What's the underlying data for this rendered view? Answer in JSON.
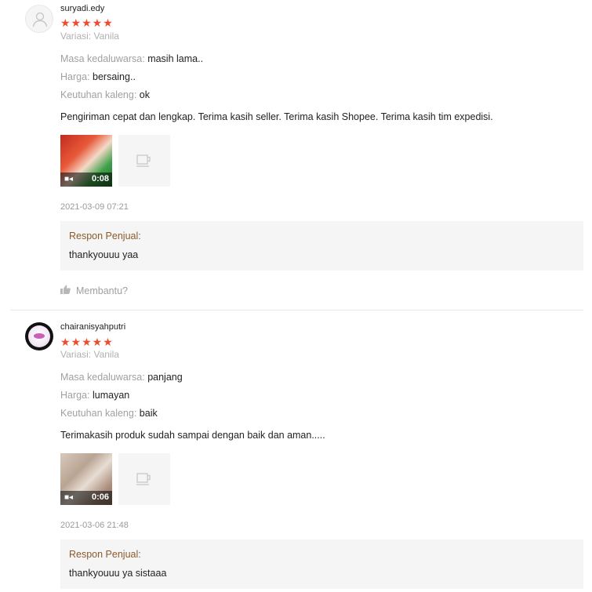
{
  "reviews": [
    {
      "username": "suryadi.edy",
      "stars": "★★★★★",
      "variation": "Variasi: Vanila",
      "attributes": [
        {
          "key": "Masa kedaluwarsa:",
          "value": "masih lama.."
        },
        {
          "key": "Harga:",
          "value": "bersaing.."
        },
        {
          "key": "Keutuhan kaleng:",
          "value": "ok"
        }
      ],
      "comment": "Pengiriman cepat dan lengkap. Terima kasih seller. Terima kasih Shopee. Terima kasih tim expedisi.",
      "video_duration": "0:08",
      "timestamp": "2021-03-09 07:21",
      "response_label": "Respon Penjual:",
      "response_text": "thankyouuu yaa",
      "helpful_label": "Membantu?"
    },
    {
      "username": "chairanisyahputri",
      "stars": "★★★★★",
      "variation": "Variasi: Vanila",
      "attributes": [
        {
          "key": "Masa kedaluwarsa:",
          "value": "panjang"
        },
        {
          "key": "Harga:",
          "value": "lumayan"
        },
        {
          "key": "Keutuhan kaleng:",
          "value": "baik"
        }
      ],
      "comment": "Terimakasih produk sudah sampai dengan baik dan aman.....",
      "video_duration": "0:06",
      "timestamp": "2021-03-06 21:48",
      "response_label": "Respon Penjual:",
      "response_text": "thankyouuu ya sistaaa"
    }
  ],
  "icons": {
    "default_avatar": "user-silhouette-icon",
    "camera": "video-camera-icon",
    "placeholder": "coffee-cup-icon",
    "helpful": "thumbs-up-icon"
  },
  "colors": {
    "star": "#ee4d2d",
    "response_label": "#8b5a2b",
    "response_bg": "#f5f5f5"
  }
}
